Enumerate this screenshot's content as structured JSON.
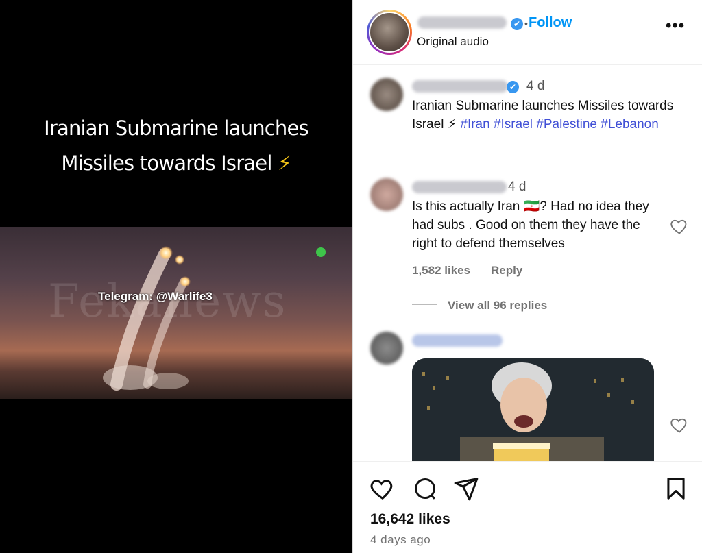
{
  "media": {
    "caption_line1": "Iranian Submarine launches",
    "caption_line2": "Missiles towards Israel",
    "caption_emoji": "⚡",
    "watermark": "Fekanews",
    "telegram_text": "Telegram: @Warlife3"
  },
  "header": {
    "verified_badge": "✔",
    "separator": "•",
    "follow_label": "Follow",
    "audio_label": "Original audio",
    "more_label": "•••"
  },
  "caption_post": {
    "time": "4 d",
    "text": "Iranian Submarine launches Missiles towards Israel ⚡",
    "hashtags": "#Iran #Israel #Palestine #Lebanon"
  },
  "comment1": {
    "time": "4 d",
    "text": "Is this actually Iran 🇮🇷? Had no idea they had subs . Good on them they have the right to defend themselves",
    "likes": "1,582 likes",
    "reply_label": "Reply",
    "view_replies": "View all 96 replies"
  },
  "actions": {
    "likes": "16,642 likes",
    "posted_ago": "4 days ago"
  },
  "colors": {
    "accent": "#0095f6",
    "hashtag": "#4150d6",
    "verified": "#3897f0"
  },
  "icons": [
    "heart-icon",
    "comment-icon",
    "share-icon",
    "bookmark-icon",
    "more-icon"
  ]
}
